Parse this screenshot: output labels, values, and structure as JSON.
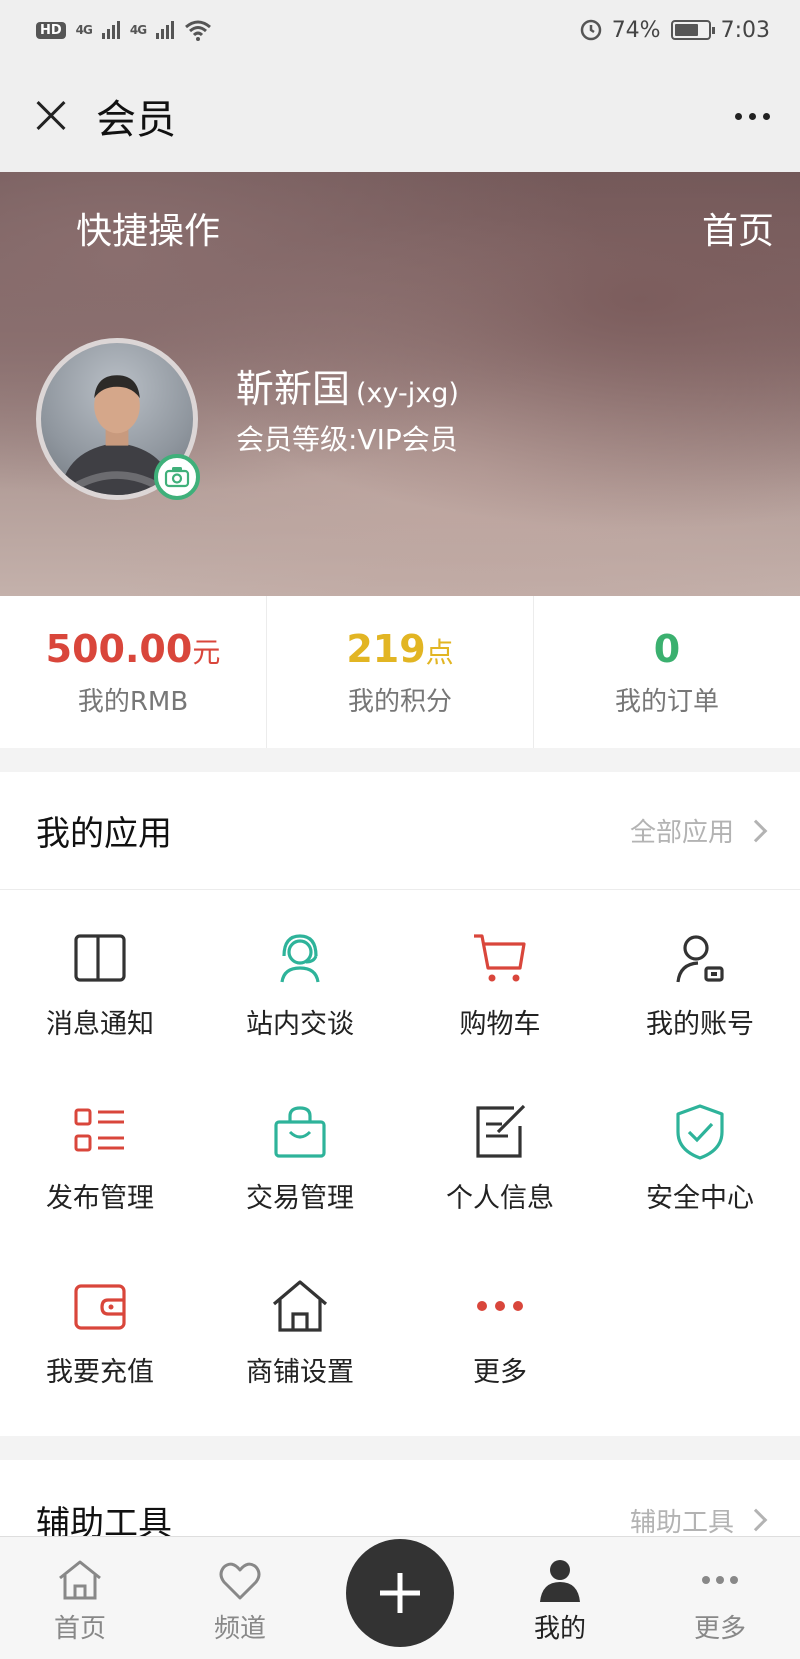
{
  "status_bar": {
    "hd": "HD",
    "signal_1": "4G",
    "signal_2": "4G",
    "battery": "74%",
    "time": "7:03"
  },
  "nav": {
    "title": "会员"
  },
  "hero": {
    "quick_actions": "快捷操作",
    "home": "首页",
    "name": "靳新国",
    "handle": "(xy-jxg)",
    "level": "会员等级:VIP会员"
  },
  "stats": [
    {
      "value": "500.00",
      "unit": "元",
      "label": "我的RMB",
      "color": "#d9463b"
    },
    {
      "value": "219",
      "unit": "点",
      "label": "我的积分",
      "color": "#e2b523"
    },
    {
      "value": "0",
      "unit": "",
      "label": "我的订单",
      "color": "#3bb06f"
    }
  ],
  "apps": {
    "title": "我的应用",
    "all_label": "全部应用",
    "items": [
      {
        "label": "消息通知",
        "icon": "book-icon"
      },
      {
        "label": "站内交谈",
        "icon": "headset-icon"
      },
      {
        "label": "购物车",
        "icon": "cart-icon"
      },
      {
        "label": "我的账号",
        "icon": "user-card-icon"
      },
      {
        "label": "发布管理",
        "icon": "list-icon"
      },
      {
        "label": "交易管理",
        "icon": "bag-icon"
      },
      {
        "label": "个人信息",
        "icon": "edit-icon"
      },
      {
        "label": "安全中心",
        "icon": "shield-icon"
      },
      {
        "label": "我要充值",
        "icon": "wallet-icon"
      },
      {
        "label": "商铺设置",
        "icon": "house-icon"
      },
      {
        "label": "更多",
        "icon": "more-dots-icon"
      }
    ]
  },
  "tools": {
    "title": "辅助工具",
    "more_label": "辅助工具"
  },
  "tab_bar": {
    "items": [
      {
        "label": "首页",
        "icon": "home-icon"
      },
      {
        "label": "频道",
        "icon": "heart-icon"
      },
      {
        "label": "我的",
        "icon": "person-icon"
      },
      {
        "label": "更多",
        "icon": "more-icon"
      }
    ]
  },
  "colors": {
    "red": "#d9463b",
    "teal": "#2eb39a",
    "dark": "#333333",
    "gold": "#e2b523",
    "green": "#3bb06f"
  }
}
